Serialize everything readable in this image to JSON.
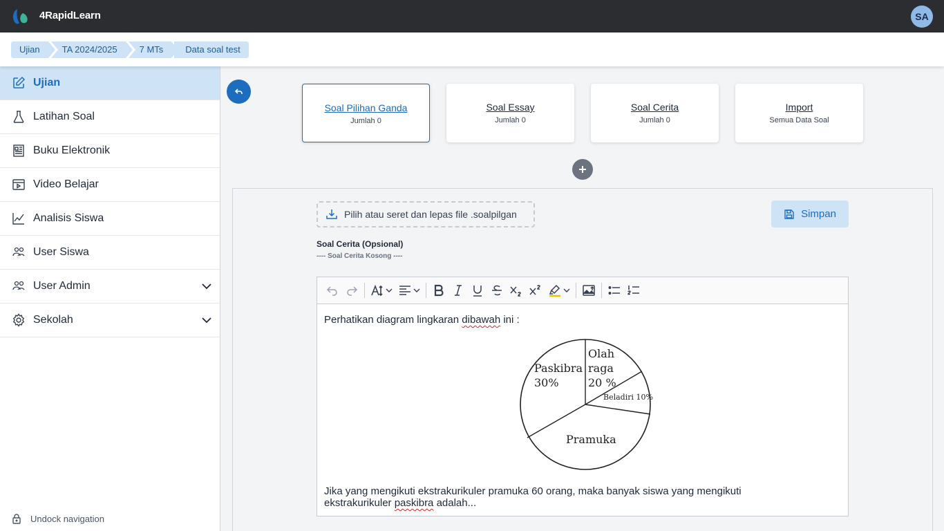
{
  "app": {
    "brand": "4RapidLearn",
    "avatar_initials": "SA"
  },
  "colors": {
    "accent": "#1c6cc0",
    "accent_light": "#cfe3f7",
    "topbar": "#2b2d31"
  },
  "breadcrumb": [
    "Ujian",
    "TA 2024/2025",
    "7 MTs",
    "Data soal test"
  ],
  "sidebar": {
    "items": [
      {
        "label": "Ujian",
        "icon": "edit-icon",
        "active": true
      },
      {
        "label": "Latihan Soal",
        "icon": "flask-icon"
      },
      {
        "label": "Buku Elektronik",
        "icon": "book-icon"
      },
      {
        "label": "Video Belajar",
        "icon": "video-icon"
      },
      {
        "label": "Analisis Siswa",
        "icon": "chart-line-icon"
      },
      {
        "label": "User Siswa",
        "icon": "users-icon"
      },
      {
        "label": "User Admin",
        "icon": "users-icon",
        "expandable": true
      },
      {
        "label": "Sekolah",
        "icon": "gear-icon",
        "expandable": true
      }
    ],
    "undock_label": "Undock navigation"
  },
  "cards": [
    {
      "title": "Soal Pilihan Ganda",
      "sub": "Jumlah 0"
    },
    {
      "title": "Soal Essay",
      "sub": "Jumlah 0"
    },
    {
      "title": "Soal Cerita",
      "sub": "Jumlah 0"
    },
    {
      "title": "Import",
      "sub": "Semua Data Soal"
    }
  ],
  "form": {
    "dropzone_label": "Pilih atau seret dan lepas file .soalpilgan",
    "save_label": "Simpan",
    "cerita_label": "Soal Cerita (Opsional)",
    "cerita_empty": "---- Soal Cerita Kosong ----"
  },
  "editor": {
    "line1_a": "Perhatikan diagram lingkaran ",
    "line1_spell": "dibawah",
    "line1_b": " ini :",
    "pie_labels": {
      "paskibra": "Paskibra",
      "paskibra_pct": "30%",
      "olah1": "Olah",
      "olah2": "raga",
      "olah_pct": "20 %",
      "beladiri": "Beladiri 10%",
      "pramuka": "Pramuka"
    },
    "line2_a": "Jika yang mengikuti ekstrakurikuler pramuka 60 orang, maka banyak siswa yang mengikuti ekstrakurikuler ",
    "line2_spell": "paskibra",
    "line2_b": " adalah..."
  }
}
